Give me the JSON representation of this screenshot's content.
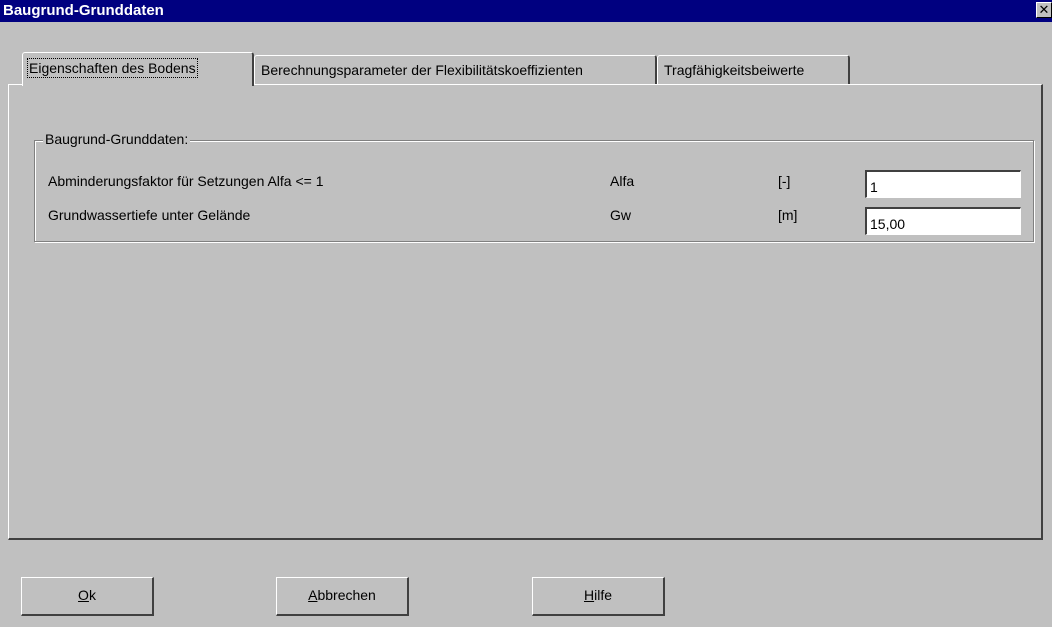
{
  "window": {
    "title": "Baugrund-Grunddaten",
    "close_glyph": "✕"
  },
  "tabs": [
    {
      "label": "Eigenschaften des Bodens",
      "active": true
    },
    {
      "label": "Berechnungsparameter der Flexibilitätskoeffizienten",
      "active": false
    },
    {
      "label": "Tragfähigkeitsbeiwerte",
      "active": false
    }
  ],
  "group": {
    "title": "Baugrund-Grunddaten:",
    "rows": [
      {
        "label": "Abminderungsfaktor für Setzungen Alfa <= 1",
        "symbol": "Alfa",
        "unit": "[-]",
        "value": "1"
      },
      {
        "label": "Grundwassertiefe unter Gelände",
        "symbol": "Gw",
        "unit": "[m]",
        "value": "15,00"
      }
    ]
  },
  "buttons": {
    "ok": {
      "mnemonic": "O",
      "rest": "k"
    },
    "cancel": {
      "mnemonic": "A",
      "rest": "bbrechen"
    },
    "help": {
      "mnemonic": "H",
      "rest": "ilfe"
    }
  }
}
